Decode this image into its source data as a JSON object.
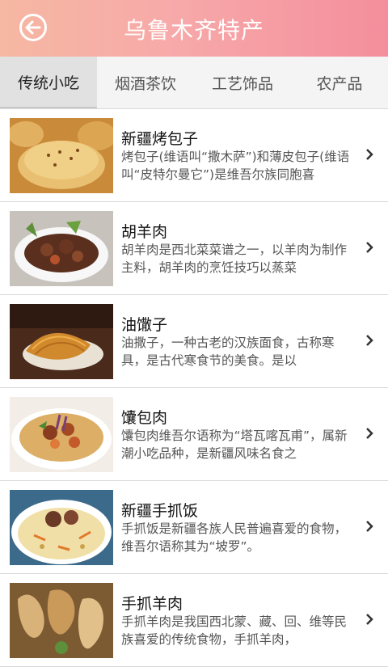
{
  "header": {
    "title": "乌鲁木齐特产"
  },
  "tabs": [
    {
      "label": "传统小吃",
      "active": true
    },
    {
      "label": "烟酒茶饮",
      "active": false
    },
    {
      "label": "工艺饰品",
      "active": false
    },
    {
      "label": "农产品",
      "active": false
    }
  ],
  "items": [
    {
      "title": "新疆烤包子",
      "desc": "烤包子(维语叫“撒木萨”)和薄皮包子(维语叫“皮特尔曼它”)是维吾尔族同胞喜"
    },
    {
      "title": "胡羊肉",
      "desc": "胡羊肉是西北菜菜谱之一，以羊肉为制作主料，胡羊肉的烹饪技巧以蒸菜"
    },
    {
      "title": "油馓子",
      "desc": "油撒子，一种古老的汉族面食，古称寒具，是古代寒食节的美食。是以"
    },
    {
      "title": "馕包肉",
      "desc": "馕包肉维吾尔语称为“塔瓦喀瓦甫”，属新潮小吃品种，是新疆风味名食之"
    },
    {
      "title": "新疆手抓饭",
      "desc": "手抓饭是新疆各族人民普遍喜爱的食物，维吾尔语称其为“坡罗”。"
    },
    {
      "title": "手抓羊肉",
      "desc": "手抓羊肉是我国西北蒙、藏、回、维等民族喜爱的传统食物，手抓羊肉，"
    }
  ],
  "icons": {
    "back": "back-arrow-icon",
    "chevron": "chevron-right-icon"
  },
  "colors": {
    "header_start": "#f6b8a2",
    "header_end": "#f48e9c"
  }
}
